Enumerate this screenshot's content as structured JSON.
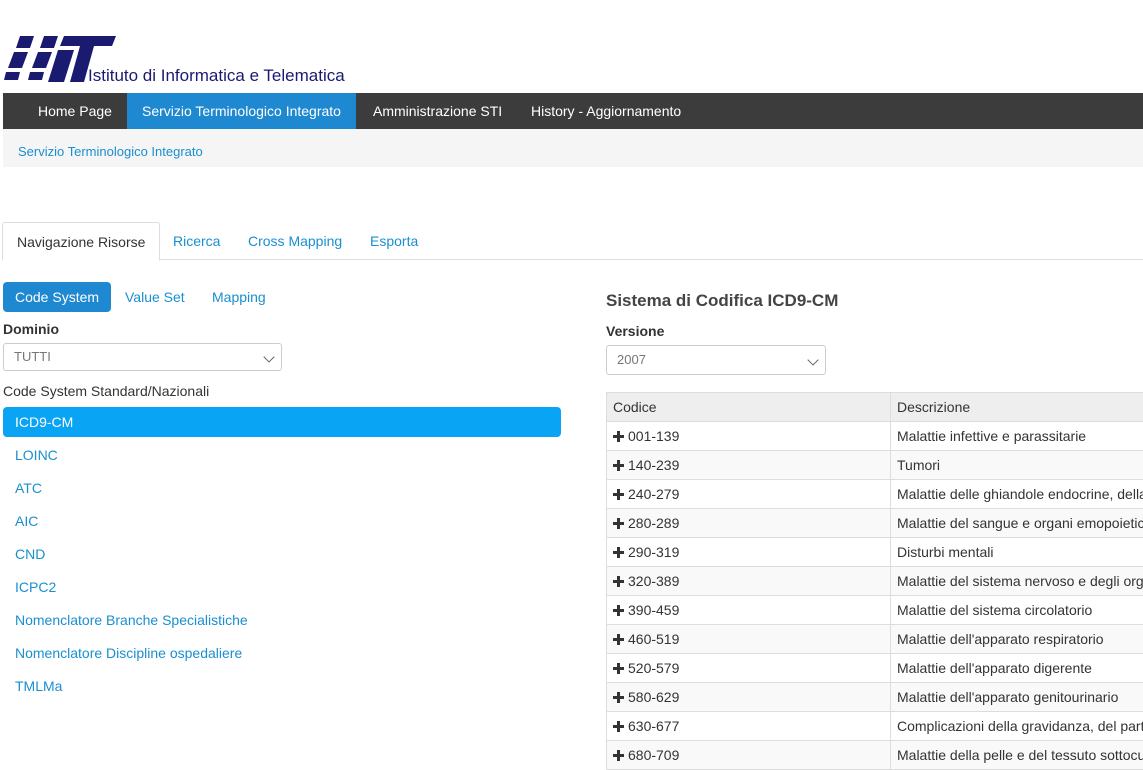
{
  "header": {
    "logo_alt": "IIT",
    "institute_name": "Istituto di Informatica e Telematica"
  },
  "topnav": {
    "items": [
      {
        "label": "Home Page",
        "active": false
      },
      {
        "label": "Servizio Terminologico Integrato",
        "active": true
      },
      {
        "label": "Amministrazione STI",
        "active": false
      },
      {
        "label": "History - Aggiornamento",
        "active": false
      }
    ]
  },
  "breadcrumb": "Servizio Terminologico Integrato",
  "tabs": [
    {
      "label": "Navigazione Risorse",
      "active": true
    },
    {
      "label": "Ricerca",
      "active": false
    },
    {
      "label": "Cross Mapping",
      "active": false
    },
    {
      "label": "Esporta",
      "active": false
    }
  ],
  "pills": [
    {
      "label": "Code System",
      "active": true
    },
    {
      "label": "Value Set",
      "active": false
    },
    {
      "label": "Mapping",
      "active": false
    }
  ],
  "left": {
    "dominio_label": "Dominio",
    "dominio_value": "TUTTI",
    "section_label": "Code System Standard/Nazionali",
    "code_systems": [
      {
        "label": "ICD9-CM",
        "active": true
      },
      {
        "label": "LOINC",
        "active": false
      },
      {
        "label": "ATC",
        "active": false
      },
      {
        "label": "AIC",
        "active": false
      },
      {
        "label": "CND",
        "active": false
      },
      {
        "label": "ICPC2",
        "active": false
      },
      {
        "label": "Nomenclatore Branche Specialistiche",
        "active": false
      },
      {
        "label": "Nomenclatore Discipline ospedaliere",
        "active": false
      },
      {
        "label": "TMLMa",
        "active": false
      }
    ]
  },
  "right": {
    "title": "Sistema di Codifica ICD9-CM",
    "versione_label": "Versione",
    "versione_value": "2007",
    "table": {
      "headers": [
        "Codice",
        "Descrizione"
      ],
      "rows": [
        {
          "code": "001-139",
          "desc": "Malattie infettive e parassitarie"
        },
        {
          "code": "140-239",
          "desc": "Tumori"
        },
        {
          "code": "240-279",
          "desc": "Malattie delle ghiandole endocrine, della nutrizione e del metabolismo"
        },
        {
          "code": "280-289",
          "desc": "Malattie del sangue e organi emopoietici"
        },
        {
          "code": "290-319",
          "desc": "Disturbi mentali"
        },
        {
          "code": "320-389",
          "desc": "Malattie del sistema nervoso e degli organi di senso"
        },
        {
          "code": "390-459",
          "desc": "Malattie del sistema circolatorio"
        },
        {
          "code": "460-519",
          "desc": "Malattie dell'apparato respiratorio"
        },
        {
          "code": "520-579",
          "desc": "Malattie dell'apparato digerente"
        },
        {
          "code": "580-629",
          "desc": "Malattie dell'apparato genitourinario"
        },
        {
          "code": "630-677",
          "desc": "Complicazioni della gravidanza, del parto e del puerperio"
        },
        {
          "code": "680-709",
          "desc": "Malattie della pelle e del tessuto sottocutaneo"
        }
      ]
    }
  },
  "colors": {
    "nav_bg": "#3c3c3c",
    "accent": "#1e88d0",
    "link": "#1a8fd0",
    "list_active": "#0aa4f5",
    "logo_blue": "#1a1a70"
  }
}
